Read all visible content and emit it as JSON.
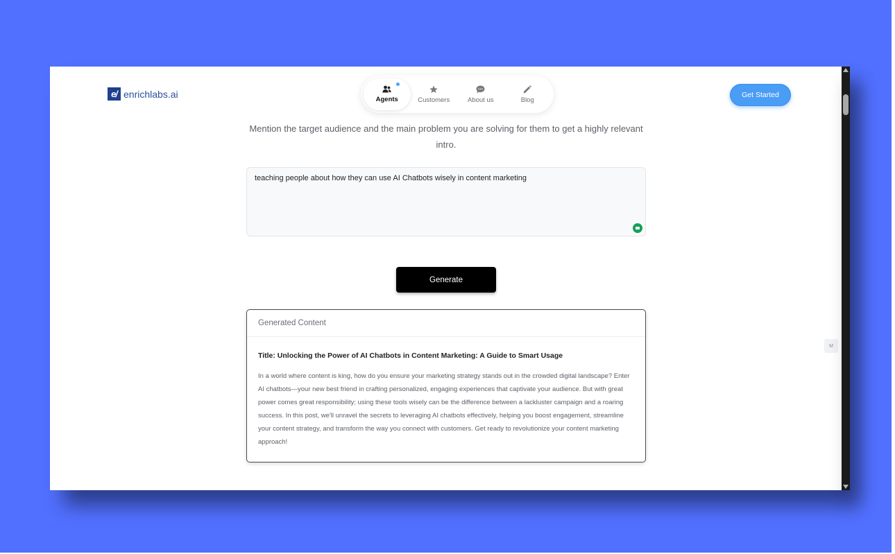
{
  "header": {
    "logo_mark": "e/",
    "logo_text": "enrichlabs.ai",
    "cta_label": "Get Started"
  },
  "nav": {
    "items": [
      {
        "label": "Agents",
        "icon": "users-icon",
        "active": true
      },
      {
        "label": "Customers",
        "icon": "star-icon",
        "active": false
      },
      {
        "label": "About us",
        "icon": "chat-bubble-icon",
        "active": false
      },
      {
        "label": "Blog",
        "icon": "pencil-icon",
        "active": false
      }
    ]
  },
  "form": {
    "instruction": "Mention the target audience and the main problem you are solving for them to get a highly relevant intro.",
    "input_value": "teaching people about how they can use AI Chatbots wisely in content marketing",
    "generate_label": "Generate"
  },
  "result": {
    "header": "Generated Content",
    "title": "Title: Unlocking the Power of AI Chatbots in Content Marketing: A Guide to Smart Usage",
    "body": "In a world where content is king, how do you ensure your marketing strategy stands out in the crowded digital landscape? Enter AI chatbots—your new best friend in crafting personalized, engaging experiences that captivate your audience. But with great power comes great responsibility; using these tools wisely can be the difference between a lackluster campaign and a roaring success. In this post, we'll unravel the secrets to leveraging AI chatbots effectively, helping you boost engagement, streamline your content strategy, and transform the way you connect with customers. Get ready to revolutionize your content marketing approach!"
  },
  "side_widget": {
    "label": "M"
  },
  "colors": {
    "background": "#5170ff",
    "accent": "#4a9df5",
    "logo": "#1f3f8f",
    "grammarly": "#15a05b"
  }
}
